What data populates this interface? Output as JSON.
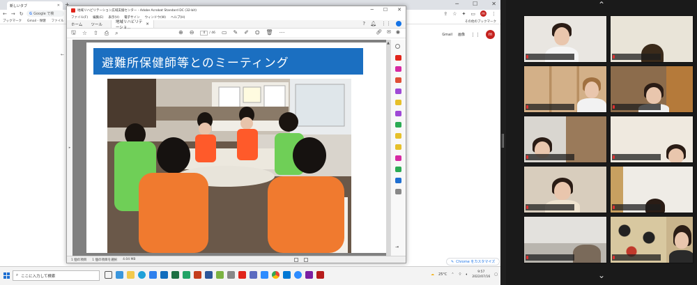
{
  "chrome": {
    "tab_title": "新しいタブ",
    "tab_close": "✕",
    "new_tab": "+",
    "window_controls": [
      "─",
      "☐",
      "✕"
    ],
    "nav": [
      "←",
      "→",
      "↻"
    ],
    "omnibox_text": "Google で検",
    "bookmarks": [
      "ブックマーク",
      "Gmail - 保健",
      "ファイル"
    ],
    "other_bookmarks": "その他のブックマーク",
    "side_text": "ワイ\nに\nコ",
    "gmail_label": "Gmail",
    "images_label": "画像",
    "avatar_letter": "m",
    "customize_label": "Chrome をカスタマイズ"
  },
  "acrobat": {
    "window_title": "地域リハビリテーション広域支援センター - Adobe Acrobat Standard DC (32-bit)",
    "menu": [
      "ファイル(F)",
      "編集(E)",
      "表示(V)",
      "電子サイン",
      "ウィンドウ(W)",
      "ヘルプ(H)"
    ],
    "tabs": {
      "home": "ホーム",
      "tools": "ツール",
      "doc": "地域リハビリテーショ..."
    },
    "page_current": "4",
    "page_total": "/ 46",
    "slide_title": "避難所保健師等とのミーティング",
    "status": [
      "1 個の項目",
      "1 個の項目を選択",
      "4.04 MB"
    ]
  },
  "taskbar": {
    "search_placeholder": "ここに入力して検索",
    "weather": "25°C",
    "time": "9:57",
    "date": "2022/07/16"
  },
  "colors": {
    "slide_title_bg": "#1b6fc1",
    "adobe_red": "#e1251b",
    "zoom_muted": "#e02f2f"
  }
}
